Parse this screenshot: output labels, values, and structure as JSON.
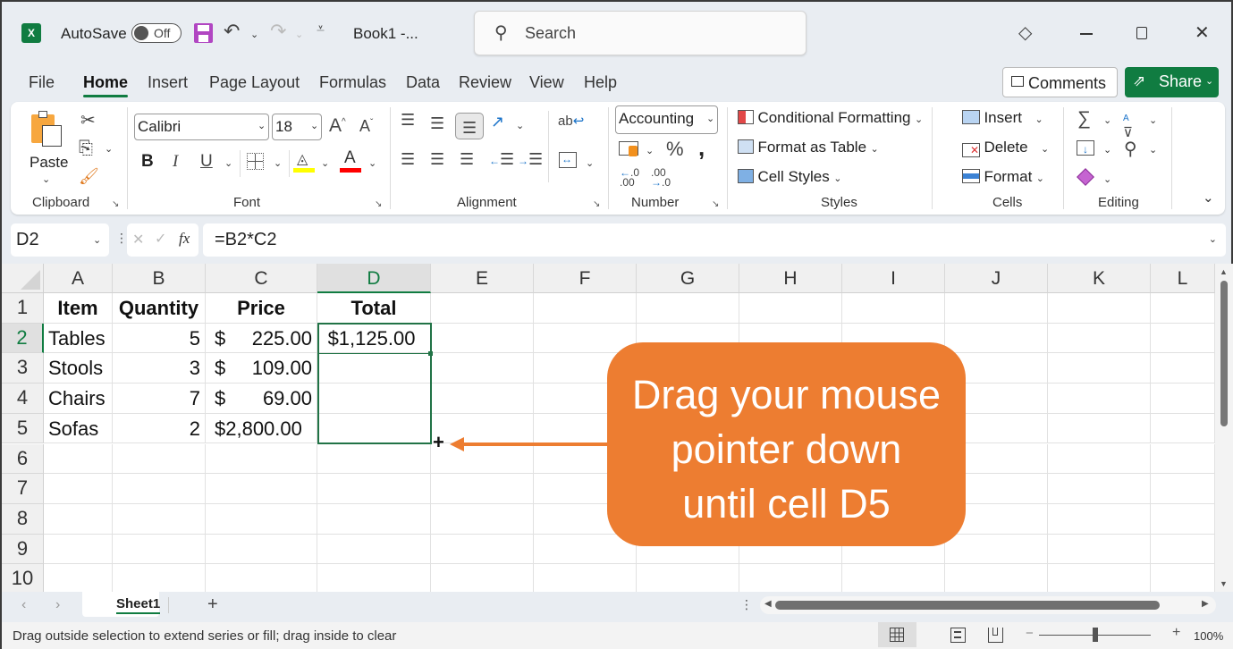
{
  "titlebar": {
    "app_icon": "excel-logo-icon",
    "autosave_label": "AutoSave",
    "autosave_state": "Off",
    "doc_title": "Book1  -...",
    "search_placeholder": "Search"
  },
  "menu_tabs": [
    "File",
    "Home",
    "Insert",
    "Page Layout",
    "Formulas",
    "Data",
    "Review",
    "View",
    "Help"
  ],
  "active_tab": "Home",
  "header_buttons": {
    "comments": "Comments",
    "share": "Share"
  },
  "ribbon": {
    "clipboard": {
      "paste": "Paste",
      "group_label": "Clipboard"
    },
    "font": {
      "font_name": "Calibri",
      "font_size": "18",
      "group_label": "Font",
      "fill_color": "#ffff00",
      "font_color": "#ff0000"
    },
    "alignment": {
      "group_label": "Alignment"
    },
    "number": {
      "format": "Accounting",
      "group_label": "Number"
    },
    "styles": {
      "conditional": "Conditional Formatting",
      "format_table": "Format as Table",
      "cell_styles": "Cell Styles",
      "group_label": "Styles"
    },
    "cells": {
      "insert": "Insert",
      "delete": "Delete",
      "format": "Format",
      "group_label": "Cells"
    },
    "editing": {
      "group_label": "Editing"
    }
  },
  "formula_bar": {
    "name_box": "D2",
    "formula": "=B2*C2"
  },
  "columns": [
    "A",
    "B",
    "C",
    "D",
    "E",
    "F",
    "G",
    "H",
    "I",
    "J",
    "K",
    "L"
  ],
  "selected_column": "D",
  "rows": [
    "1",
    "2",
    "3",
    "4",
    "5",
    "6",
    "7",
    "8",
    "9",
    "10"
  ],
  "selected_row": "2",
  "cells": {
    "A1": "Item",
    "B1": "Quantity",
    "C1": "Price",
    "D1": "Total",
    "A2": "Tables",
    "B2": "5",
    "C2_sym": "$",
    "C2": "225.00",
    "D2": "$1,125.00",
    "A3": "Stools",
    "B3": "3",
    "C3_sym": "$",
    "C3": "109.00",
    "A4": "Chairs",
    "B4": "7",
    "C4_sym": "$",
    "C4": "69.00",
    "A5": "Sofas",
    "B5": "2",
    "C5": "$2,800.00"
  },
  "fill_cursor": "+",
  "callout": {
    "line1": "Drag your mouse",
    "line2": "pointer down",
    "line3": "until cell D5",
    "color": "#ed7d31"
  },
  "sheet_tabs": [
    "Sheet1"
  ],
  "add_sheet": "+",
  "status": {
    "message": "Drag outside selection to extend series or fill; drag inside to clear",
    "zoom": "100%",
    "zoom_fraction": 0.5
  }
}
